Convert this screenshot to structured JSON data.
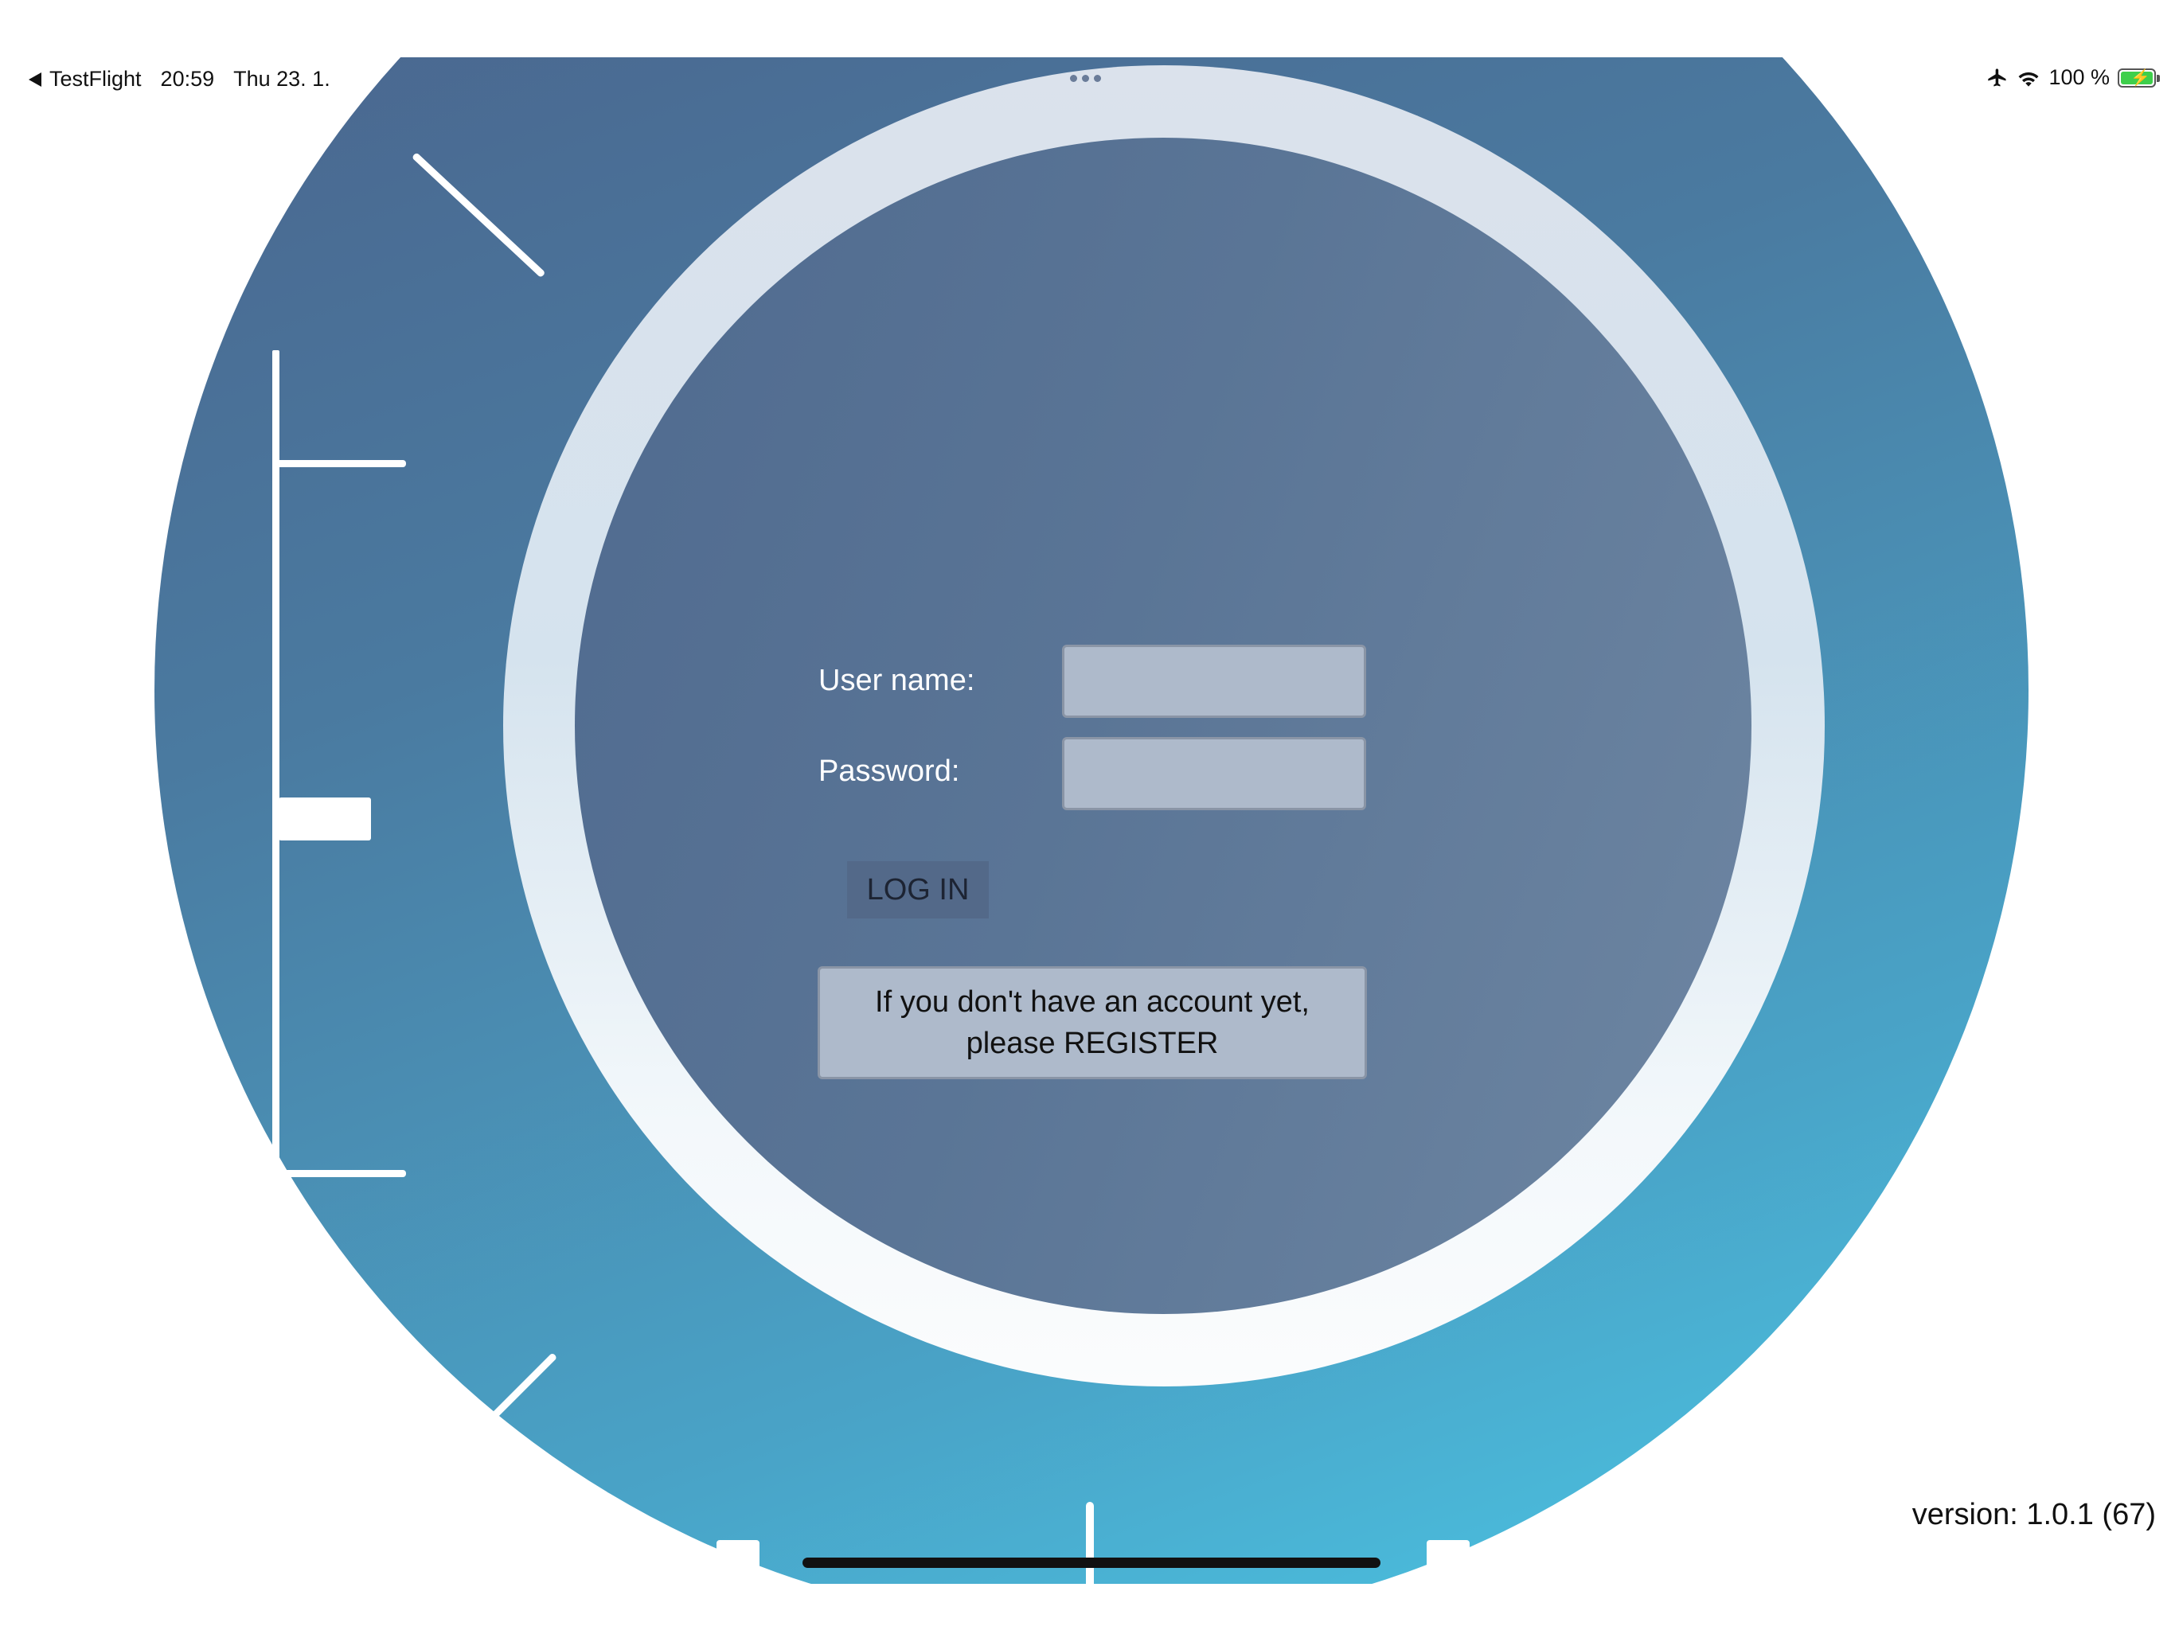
{
  "status_bar": {
    "back_app": "TestFlight",
    "time": "20:59",
    "date": "Thu 23. 1.",
    "battery": "100 %",
    "icons": [
      "back-arrow-icon",
      "airplane-icon",
      "wifi-icon",
      "battery-charging-icon"
    ]
  },
  "login": {
    "username_label": "User name:",
    "username_value": "",
    "password_label": "Password:",
    "password_value": "",
    "login_button": "LOG IN",
    "register_line1": "If you don't have an account yet,",
    "register_line2": "please REGISTER"
  },
  "footer": {
    "version": "version: 1.0.1 (67)"
  },
  "colors": {
    "dial_gradient_start": "#4b5f88",
    "dial_gradient_end": "#4bc8e6",
    "face": "#5a7596",
    "field_bg": "#aebacb",
    "battery_fill": "#3ecf4b"
  }
}
